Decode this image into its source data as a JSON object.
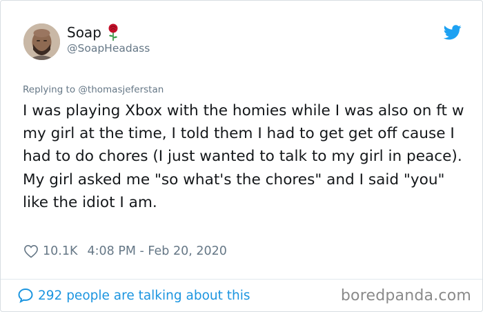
{
  "author": {
    "display_name": "Soap",
    "handle": "@SoapHeadass",
    "name_emoji": "rose-icon"
  },
  "reply": {
    "prefix": "Replying to",
    "target": "@thomasjeferstan"
  },
  "tweet": {
    "text": "I was playing Xbox with the homies while I was also on ft w my girl at the time, I told them I had to get get off cause I had to do chores (I just wanted to talk to my girl in peace). My girl asked me \"so what's the chores\" and I said \"you\" like the idiot I am.",
    "likes": "10.1K",
    "timestamp": "4:08 PM - Feb 20, 2020"
  },
  "footer": {
    "talking_label": "292 people are talking about this",
    "watermark": "boredpanda.com"
  },
  "colors": {
    "twitter_blue": "#1da1f2",
    "link_blue": "#1b95e0",
    "secondary_text": "#657786",
    "rose_red": "#c4102a"
  }
}
